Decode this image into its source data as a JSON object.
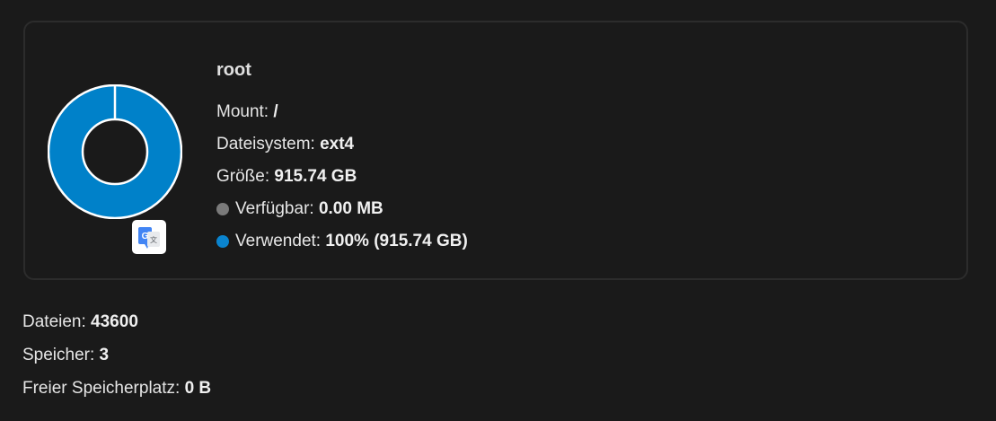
{
  "disk": {
    "name": "root",
    "mount_label": "Mount: ",
    "mount_value": "/",
    "filesystem_label": "Dateisystem: ",
    "filesystem_value": "ext4",
    "size_label": "Größe: ",
    "size_value": "915.74 GB",
    "available_label": "Verfügbar: ",
    "available_value": "0.00 MB",
    "used_label": "Verwendet: ",
    "used_value": "100% (915.74 GB)",
    "used_fraction": 1.0
  },
  "colors": {
    "used": "#0a84cf",
    "available": "#7a7a7a",
    "donut_used": "#0081c9",
    "donut_outline": "#ffffff"
  },
  "icons": {
    "translate_badge": "google-translate-icon"
  },
  "summary": {
    "files_label": "Dateien: ",
    "files_value": "43600",
    "storage_label": "Speicher: ",
    "storage_value": "3",
    "free_label": "Freier Speicherplatz: ",
    "free_value": "0 B"
  }
}
